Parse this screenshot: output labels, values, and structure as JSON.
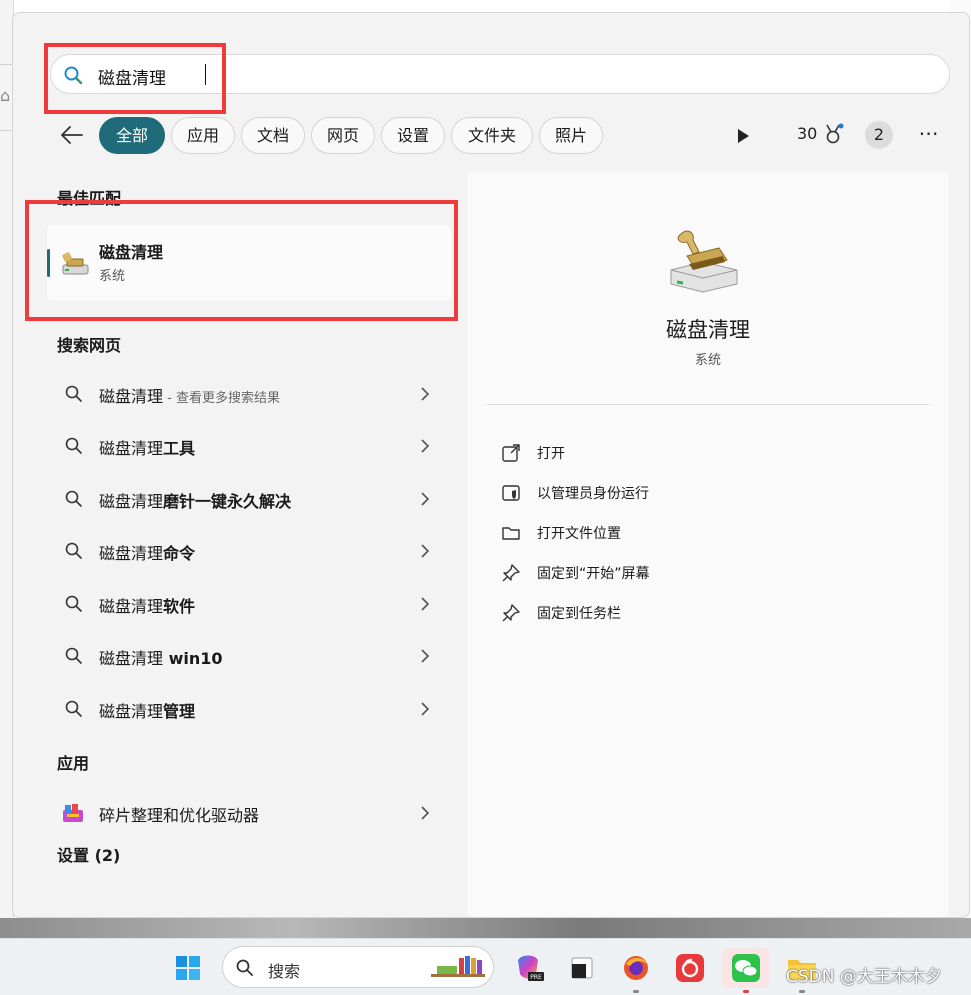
{
  "search": {
    "query": "磁盘清理"
  },
  "filters": {
    "chips": [
      "全部",
      "应用",
      "文档",
      "网页",
      "设置",
      "文件夹",
      "照片"
    ],
    "points": "30",
    "badge": "2"
  },
  "results": {
    "best_match_heading": "最佳匹配",
    "best_match": {
      "title": "磁盘清理",
      "subtitle": "系统"
    },
    "web_heading": "搜索网页",
    "web_items": [
      {
        "prefix": "磁盘清理",
        "suffix": "",
        "hint": " - 查看更多搜索结果"
      },
      {
        "prefix": "磁盘清理",
        "suffix": "工具",
        "hint": ""
      },
      {
        "prefix": "磁盘清理",
        "suffix": "磨针一键永久解决",
        "hint": ""
      },
      {
        "prefix": "磁盘清理",
        "suffix": "命令",
        "hint": ""
      },
      {
        "prefix": "磁盘清理",
        "suffix": "软件",
        "hint": ""
      },
      {
        "prefix": "磁盘清理",
        "suffix": " win10",
        "hint": ""
      },
      {
        "prefix": "磁盘清理",
        "suffix": "管理",
        "hint": ""
      }
    ],
    "apps_heading": "应用",
    "app_item": "碎片整理和优化驱动器",
    "settings_heading": "设置 (2)"
  },
  "preview": {
    "name": "磁盘清理",
    "type": "系统",
    "actions": [
      "打开",
      "以管理员身份运行",
      "打开文件位置",
      "固定到“开始”屏幕",
      "固定到任务栏"
    ]
  },
  "taskbar": {
    "search_label": "搜索",
    "watermark": "CSDN @大王木木夕"
  },
  "colors": {
    "accent": "#1f6b79",
    "highlight_box": "#ef3b3b"
  }
}
